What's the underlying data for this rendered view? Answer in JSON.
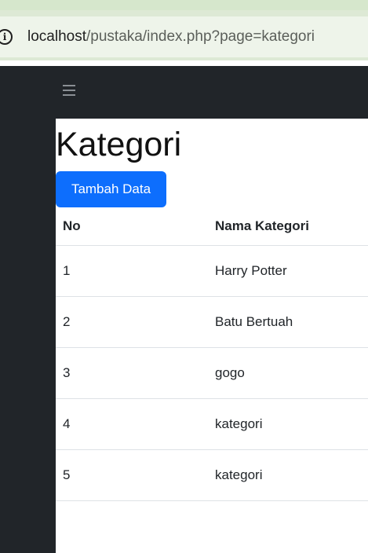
{
  "browser": {
    "url_host": "localhost",
    "url_path": "/pustaka/index.php?page=kategori",
    "site_info_icon": "info-icon"
  },
  "navbar": {
    "menu_icon": "hamburger-icon"
  },
  "main": {
    "title": "Kategori",
    "add_button_label": "Tambah Data",
    "table": {
      "headers": [
        "No",
        "Nama Kategori"
      ],
      "rows": [
        {
          "no": "1",
          "name": "Harry Potter"
        },
        {
          "no": "2",
          "name": "Batu Bertuah"
        },
        {
          "no": "3",
          "name": "gogo"
        },
        {
          "no": "4",
          "name": "kategori"
        },
        {
          "no": "5",
          "name": "kategori"
        }
      ]
    }
  }
}
